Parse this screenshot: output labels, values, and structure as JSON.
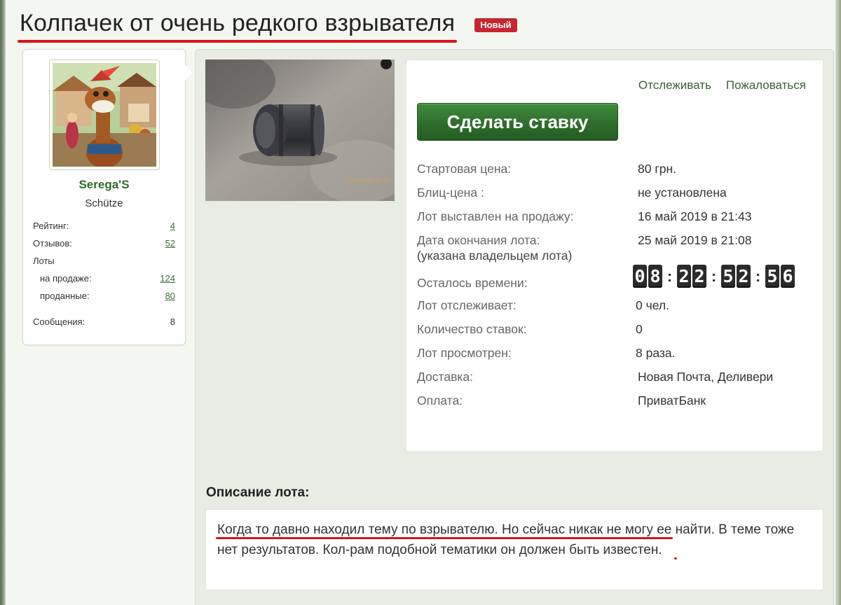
{
  "page": {
    "title": "Колпачек от очень редкого взрывателя",
    "badge": "Новый"
  },
  "seller": {
    "name": "Serega'S",
    "rank": "Schütze",
    "stats": [
      {
        "label": "Рейтинг:",
        "value": "4",
        "link": true
      },
      {
        "label": "Отзывов:",
        "value": "52",
        "link": true
      },
      {
        "label": "Лоты",
        "value": "",
        "link": false
      },
      {
        "label": "на продаже:",
        "value": "124",
        "link": true
      },
      {
        "label": "проданные:",
        "value": "80",
        "link": true
      },
      {
        "label": "Сообщения:",
        "value": "8",
        "link": false
      }
    ]
  },
  "lot": {
    "actions": {
      "watch": "Отслеживать",
      "report": "Пожаловаться"
    },
    "bid_button": "Сделать ставку",
    "details": {
      "start_price": {
        "label": "Стартовая цена:",
        "value": "80 грн."
      },
      "blitz_price": {
        "label": "Блиц-цена :",
        "value": "не установлена"
      },
      "listed": {
        "label": "Лот выставлен на продажу:",
        "value": "16 май 2019 в 21:43"
      },
      "end_date": {
        "label": "Дата окончания лота:",
        "note": "(указана владельцем лота)",
        "value": "25 май 2019 в 21:08"
      },
      "remaining": {
        "label": "Осталось времени:",
        "digits": [
          "0",
          "8",
          "2",
          "2",
          "5",
          "2",
          "5",
          "6"
        ]
      },
      "watchers": {
        "label": "Лот отслеживает:",
        "value": "0 чел."
      },
      "bids": {
        "label": "Количество ставок:",
        "value": "0"
      },
      "views": {
        "label": "Лот просмотрен:",
        "value": "8 раза."
      },
      "delivery": {
        "label": "Доставка:",
        "value": "Новая Почта, Деливери"
      },
      "payment": {
        "label": "Оплата:",
        "value": "ПриватБанк"
      }
    },
    "description": {
      "heading": "Описание лота:",
      "part1": "Когда то давно находил тему по взрывателю. Но сейчас никак не могу ее",
      "part2": "найти. В теме тоже нет результатов.",
      "part3": " Кол-рам подобной тематики он должен быть известен."
    }
  },
  "colors": {
    "accent_green": "#2f6e2d",
    "link_green": "#3b6c36",
    "badge_red": "#c8252e",
    "annotation_red": "#d9141b"
  }
}
